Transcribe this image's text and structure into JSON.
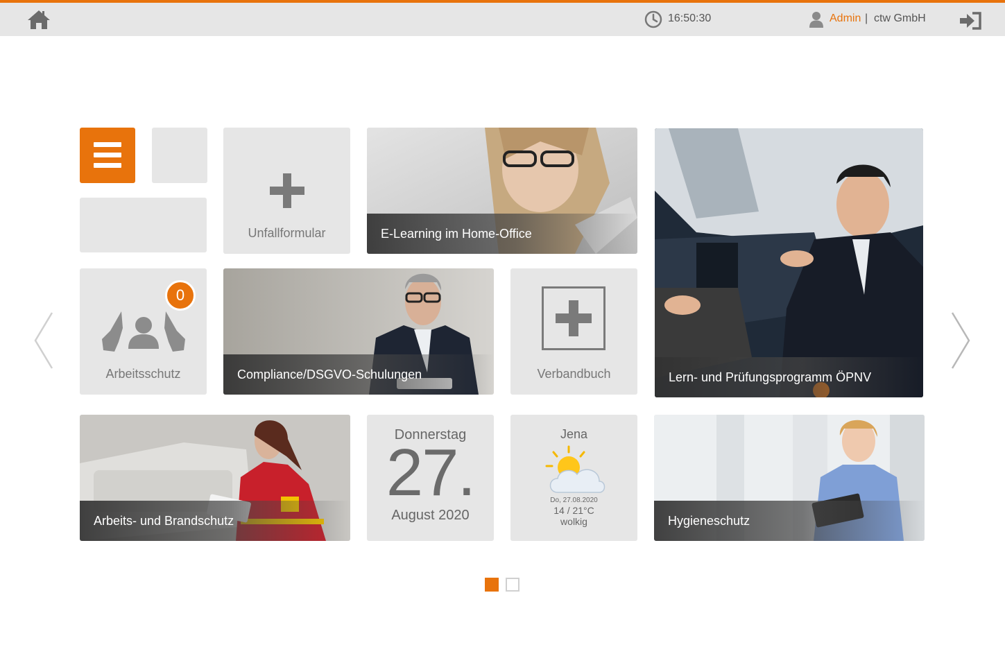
{
  "header": {
    "time": "16:50:30",
    "user": "Admin",
    "separator": "|",
    "company": "ctw GmbH",
    "icons": [
      "home-icon",
      "clock-icon",
      "user-icon",
      "logout-icon"
    ],
    "accent_color": "#e8730c"
  },
  "tiles": {
    "menu": {
      "icon": "hamburger-icon"
    },
    "unfallformular": {
      "label": "Unfallformular",
      "icon": "plus-icon"
    },
    "elearning": {
      "label": "E-Learning im Home-Office"
    },
    "arbeitsschutz": {
      "label": "Arbeitsschutz",
      "badge": "0",
      "icon": "protected-person-icon"
    },
    "compliance": {
      "label": "Compliance/DSGVO-Schulungen"
    },
    "verbandbuch": {
      "label": "Verbandbuch",
      "icon": "first-aid-plus-icon"
    },
    "opnv": {
      "label": "Lern- und Prüfungsprogramm ÖPNV"
    },
    "brandschutz": {
      "label": "Arbeits- und Brandschutz"
    },
    "date": {
      "weekday": "Donnerstag",
      "day": "27.",
      "month_year": "August 2020"
    },
    "weather": {
      "city": "Jena",
      "date": "Do, 27.08.2020",
      "temps": "14 / 21°C",
      "condition": "wolkig",
      "icon": "partly-cloudy-icon"
    },
    "hygiene": {
      "label": "Hygieneschutz"
    }
  },
  "pagination": {
    "pages": 2,
    "current": 1
  }
}
